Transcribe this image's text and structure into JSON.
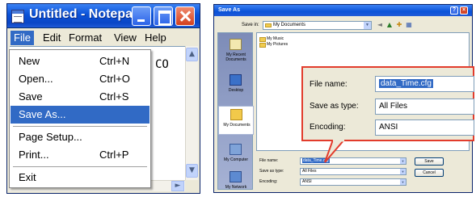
{
  "notepad": {
    "title": "Untitled - Notepa",
    "icons": {
      "app": "notepad-app-icon",
      "minimize": "minimize-icon",
      "maximize": "maximize-icon",
      "close": "close-icon"
    },
    "menubar": [
      "File",
      "Edit",
      "Format",
      "View",
      "Help"
    ],
    "file_menu": {
      "items": [
        {
          "label": "New",
          "shortcut": "Ctrl+N"
        },
        {
          "label": "Open...",
          "shortcut": "Ctrl+O"
        },
        {
          "label": "Save",
          "shortcut": "Ctrl+S"
        },
        {
          "label": "Save As...",
          "shortcut": "",
          "selected": true
        },
        {
          "label": "Page Setup...",
          "shortcut": ""
        },
        {
          "label": "Print...",
          "shortcut": "Ctrl+P"
        },
        {
          "label": "Exit",
          "shortcut": ""
        }
      ]
    },
    "document_text": "CO"
  },
  "save_as": {
    "title": "Save As",
    "save_in_label": "Save in:",
    "save_in_value": "My Documents",
    "places": [
      "My Recent Documents",
      "Desktop",
      "My Documents",
      "My Computer",
      "My Network"
    ],
    "files": [
      "My Music",
      "My Pictures"
    ],
    "file_name_label": "File name:",
    "file_name_value": "data_Time.cfg",
    "save_type_label": "Save as type:",
    "save_type_value": "All Files",
    "encoding_label": "Encoding:",
    "encoding_value": "ANSI",
    "save_button": "Save",
    "cancel_button": "Cancel"
  },
  "callout": {
    "file_name_label": "File name:",
    "file_name_value": "data_Time.cfg",
    "save_type_label": "Save as type:",
    "save_type_value": "All Files",
    "encoding_label": "Encoding:",
    "encoding_value": "ANSI",
    "border_color": "#e23c2c"
  },
  "colors": {
    "xp_blue": "#0a52d8",
    "selection": "#316ac5",
    "dialog_bg": "#ece9d8"
  }
}
